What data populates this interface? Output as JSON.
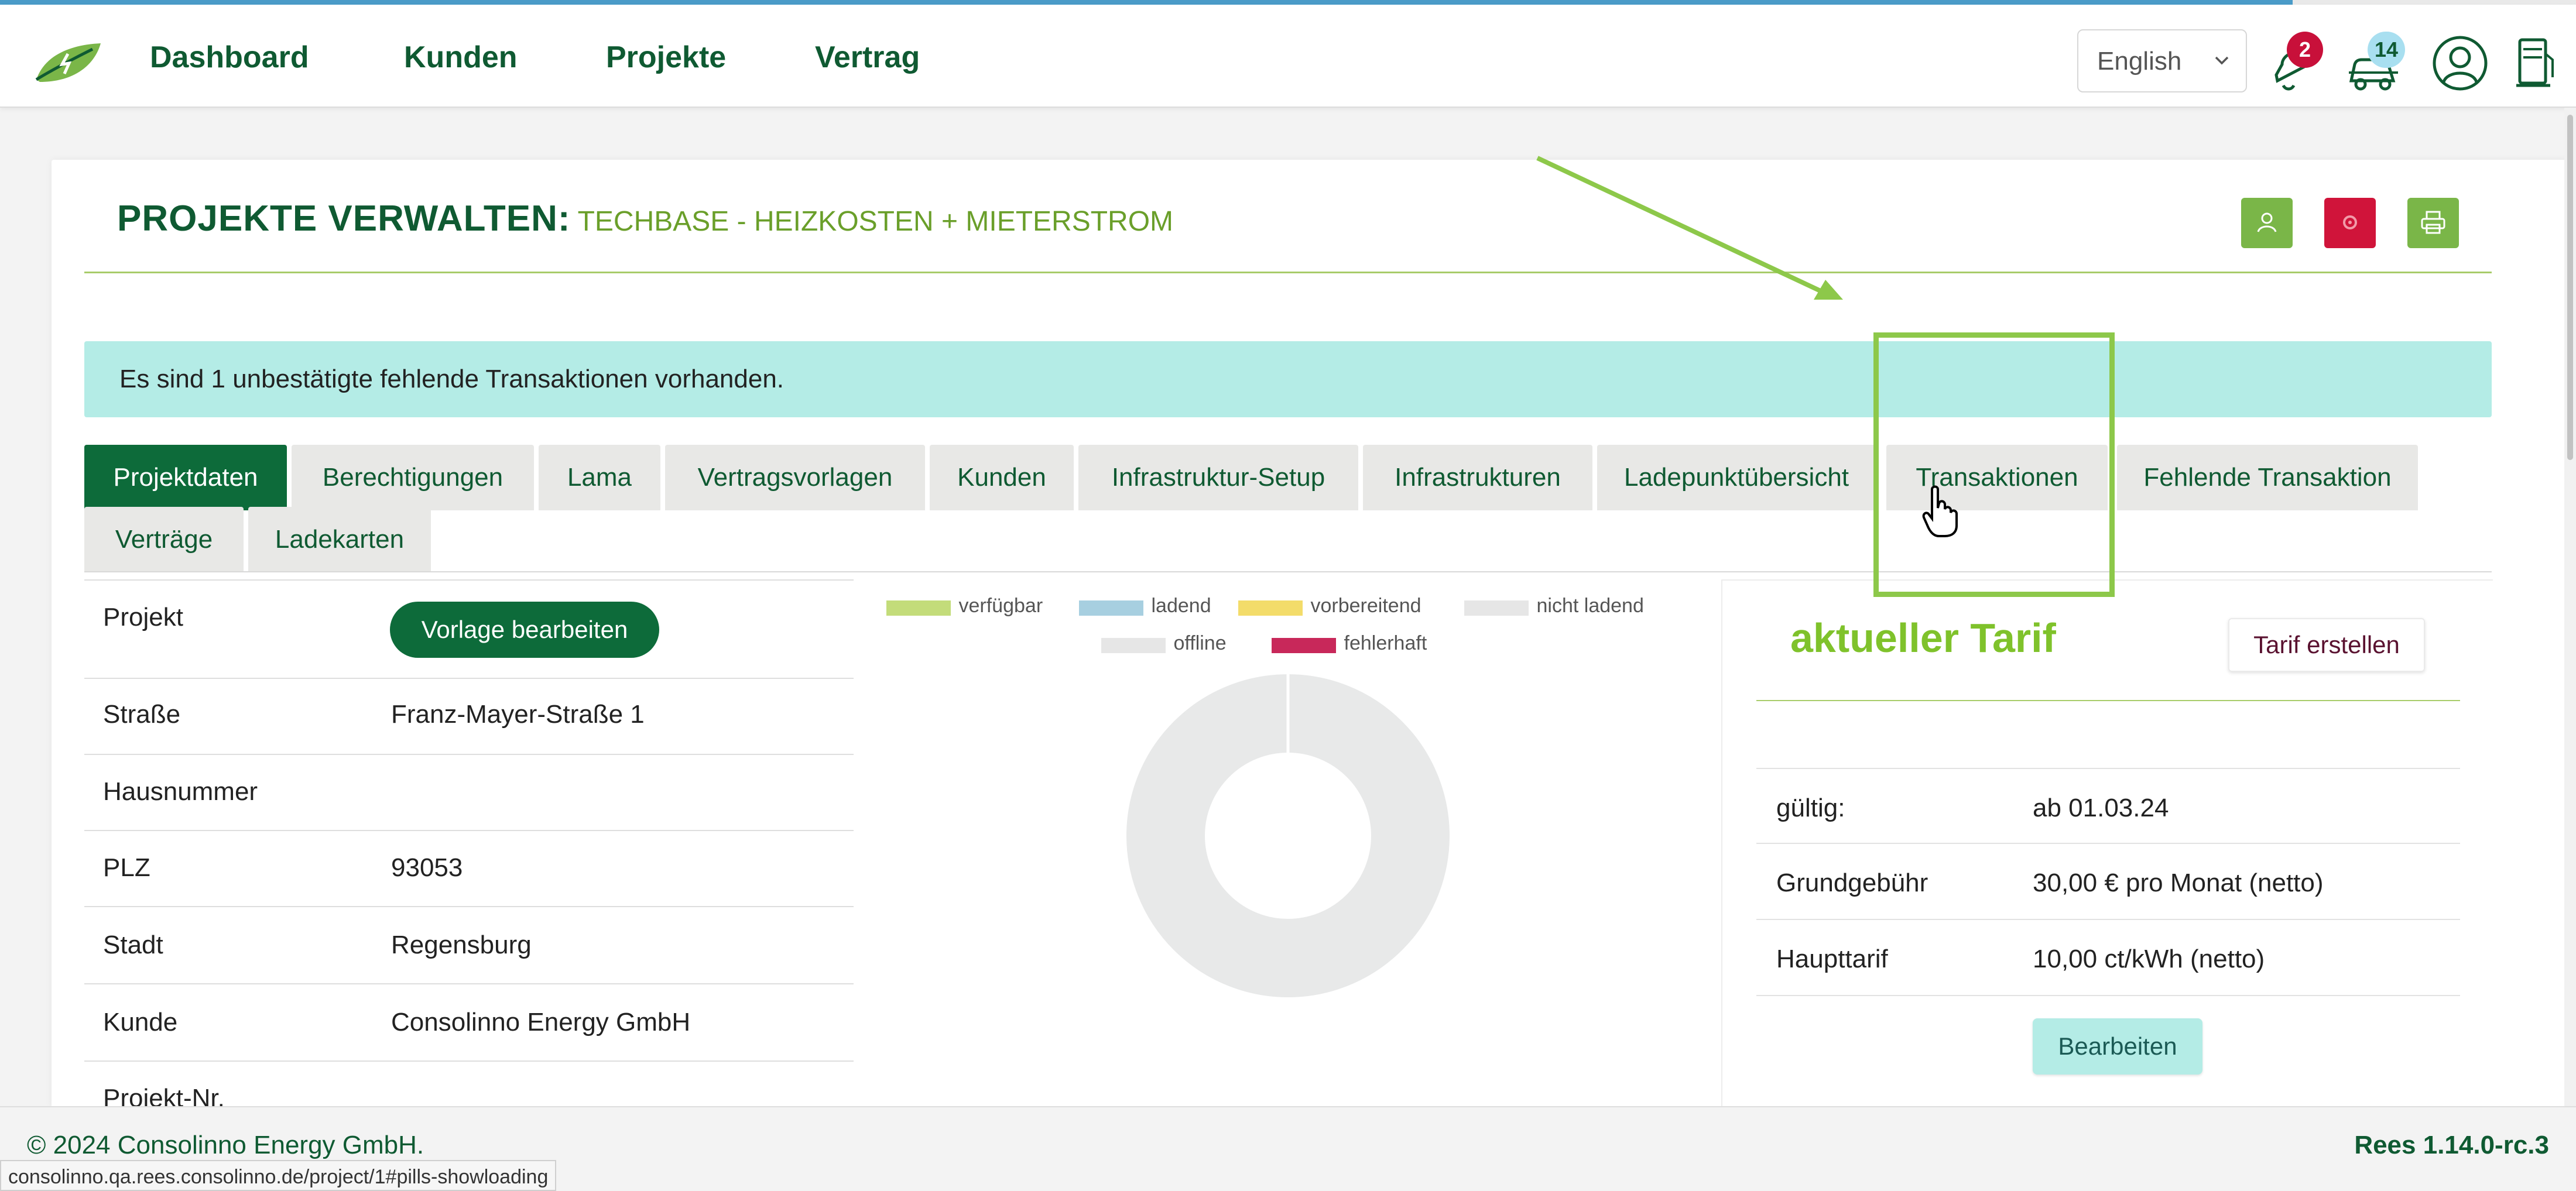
{
  "browser": {
    "loading_progress": 0.89
  },
  "navbar": {
    "logo_icon": "leaf-logo-icon",
    "links": [
      "Dashboard",
      "Kunden",
      "Projekte",
      "Vertrag"
    ],
    "language": "English",
    "notifications": {
      "icon": "bell-icon",
      "count": "2"
    },
    "charging": {
      "icon": "charging-car-icon",
      "count": "14"
    },
    "profile_icon": "user-circle-icon",
    "extra_icon": "station-icon"
  },
  "page": {
    "title_strong": "PROJEKTE VERWALTEN:",
    "title_sub": "TECHBASE - HEIZKOSTEN + MIETERSTROM",
    "header_buttons": [
      {
        "icon": "user-icon",
        "color": "#7ab648"
      },
      {
        "icon": "gear-icon",
        "color": "#d0143a"
      },
      {
        "icon": "print-icon",
        "color": "#7ab648"
      }
    ]
  },
  "alert": {
    "text": "Es sind 1 unbestätigte fehlende Transaktionen vorhanden."
  },
  "tabs": [
    "Projektdaten",
    "Berechtigungen",
    "Lama",
    "Vertragsvorlagen",
    "Kunden",
    "Infrastruktur-Setup",
    "Infrastrukturen",
    "Ladepunktübersicht",
    "Transaktionen",
    "Fehlende Transaktion",
    "Verträge",
    "Ladekarten"
  ],
  "project": {
    "rows": [
      {
        "label": "Projekt",
        "value": ""
      },
      {
        "label": "Straße",
        "value": "Franz-Mayer-Straße 1"
      },
      {
        "label": "Hausnummer",
        "value": ""
      },
      {
        "label": "PLZ",
        "value": "93053"
      },
      {
        "label": "Stadt",
        "value": "Regensburg"
      },
      {
        "label": "Kunde",
        "value": "Consolinno Energy GmbH"
      },
      {
        "label": "Projekt-Nr.",
        "value": ""
      }
    ],
    "template_button": "Vorlage bearbeiten"
  },
  "chart_data": {
    "type": "pie",
    "legend": [
      {
        "name": "verfügbar",
        "color": "#c3dc7a"
      },
      {
        "name": "ladend",
        "color": "#a7cfe0"
      },
      {
        "name": "vorbereitend",
        "color": "#f3dc6a"
      },
      {
        "name": "nicht ladend",
        "color": "#e6e6e6"
      },
      {
        "name": "offline",
        "color": "#e6e6e6"
      },
      {
        "name": "fehlerhaft",
        "color": "#c8285a"
      }
    ],
    "slices": [
      {
        "name": "nicht ladend",
        "value": 1,
        "color": "#e8e9e9"
      }
    ],
    "legend_position": "top"
  },
  "tariff": {
    "title": "aktueller Tarif",
    "create_button": "Tarif erstellen",
    "rows": [
      {
        "label": "gültig:",
        "value": "ab 01.03.24"
      },
      {
        "label": "Grundgebühr",
        "value": "30,00 € pro Monat (netto)"
      },
      {
        "label": "Haupttarif",
        "value": "10,00 ct/kWh (netto)"
      }
    ],
    "edit_button": "Bearbeiten"
  },
  "footer": {
    "copyright": "© 2024 Consolinno Energy GmbH.",
    "version": "Rees 1.14.0-rc.3"
  },
  "statusbar": {
    "url": "consolinno.qa.rees.consolinno.de/project/1#pills-showloading"
  },
  "annotation": {
    "color": "#8dc84a",
    "cursor_icon": "hand-pointer-icon"
  }
}
